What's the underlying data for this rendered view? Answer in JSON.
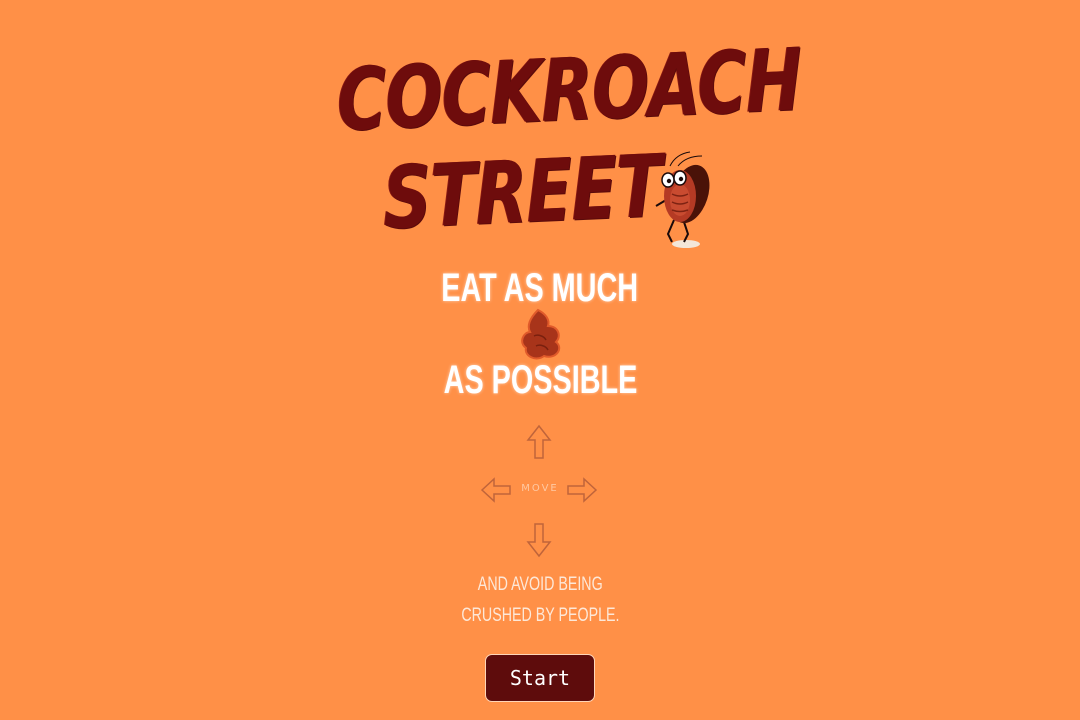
{
  "title": {
    "line1": "COCKROACH",
    "line2": "STREET"
  },
  "instructions": {
    "eat_line": "EAT AS MUCH",
    "possible_line": "AS POSSIBLE",
    "food_icon": "food-blob-icon",
    "move_label": "MOVE",
    "avoid_line1": "AND AVOID BEING",
    "avoid_line2": "CRUSHED BY PEOPLE."
  },
  "controls": {
    "icons": [
      "arrow-up-icon",
      "arrow-left-icon",
      "arrow-right-icon",
      "arrow-down-icon"
    ]
  },
  "start_button": {
    "label": "Start"
  },
  "colors": {
    "background": "#ff9047",
    "title": "#6e0c0c",
    "button_bg": "#5e0c0c",
    "text_light": "#ffffff"
  }
}
